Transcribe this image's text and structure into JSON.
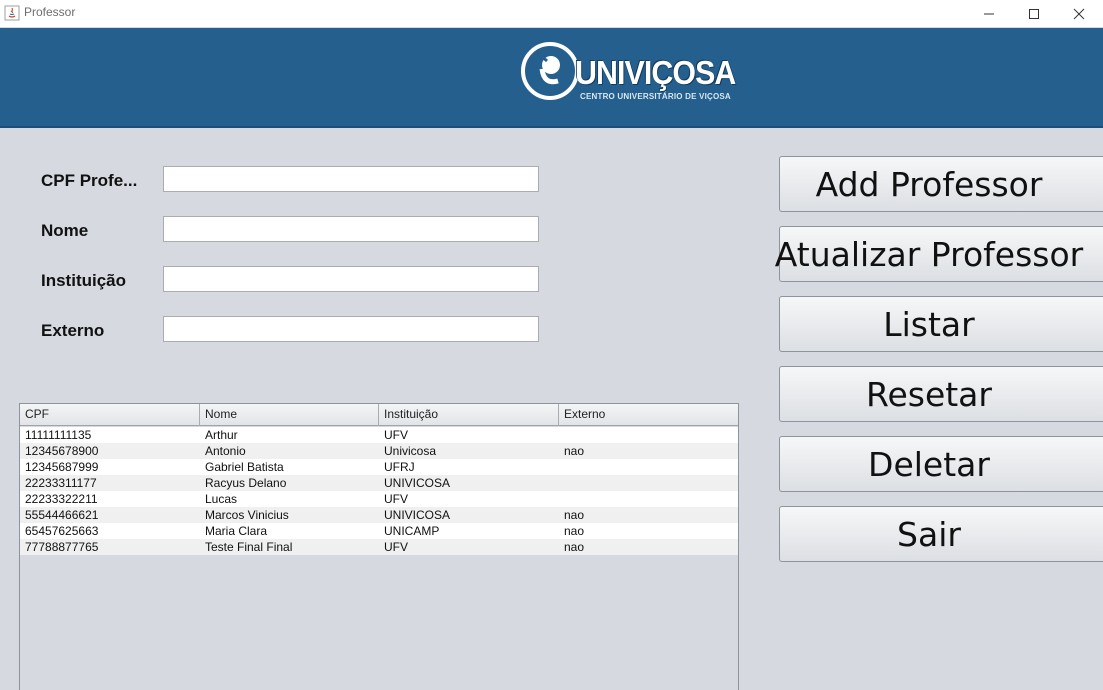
{
  "window": {
    "title": "Professor",
    "icon": "java-icon",
    "controls": [
      "minimize-icon",
      "maximize-icon",
      "close-icon"
    ]
  },
  "banner": {
    "logo_text": "UNIVIÇOSA",
    "logo_subtitle": "CENTRO UNIVERSITÁRIO DE VIÇOSA",
    "background_color": "#245f8e"
  },
  "form": {
    "fields": [
      {
        "label": "CPF Profe...",
        "value": ""
      },
      {
        "label": "Nome",
        "value": ""
      },
      {
        "label": "Instituição",
        "value": ""
      },
      {
        "label": "Externo",
        "value": ""
      }
    ]
  },
  "buttons": [
    "Add Professor",
    "Atualizar Professor",
    "Listar",
    "Resetar",
    "Deletar",
    "Sair"
  ],
  "table": {
    "columns": [
      "CPF",
      "Nome",
      "Instituição",
      "Externo"
    ],
    "rows": [
      [
        "11111111135",
        "Arthur",
        "UFV",
        ""
      ],
      [
        "12345678900",
        "Antonio",
        "Univicosa",
        "nao"
      ],
      [
        "12345687999",
        "Gabriel Batista",
        "UFRJ",
        ""
      ],
      [
        "22233311177",
        "Racyus Delano",
        "UNIVICOSA",
        ""
      ],
      [
        "22233322211",
        "Lucas",
        "UFV",
        ""
      ],
      [
        "55544466621",
        "Marcos Vinicius",
        "UNIVICOSA",
        "nao"
      ],
      [
        "65457625663",
        "Maria Clara",
        "UNICAMP",
        "nao"
      ],
      [
        "77788877765",
        "Teste Final Final",
        "UFV",
        "nao"
      ]
    ]
  }
}
